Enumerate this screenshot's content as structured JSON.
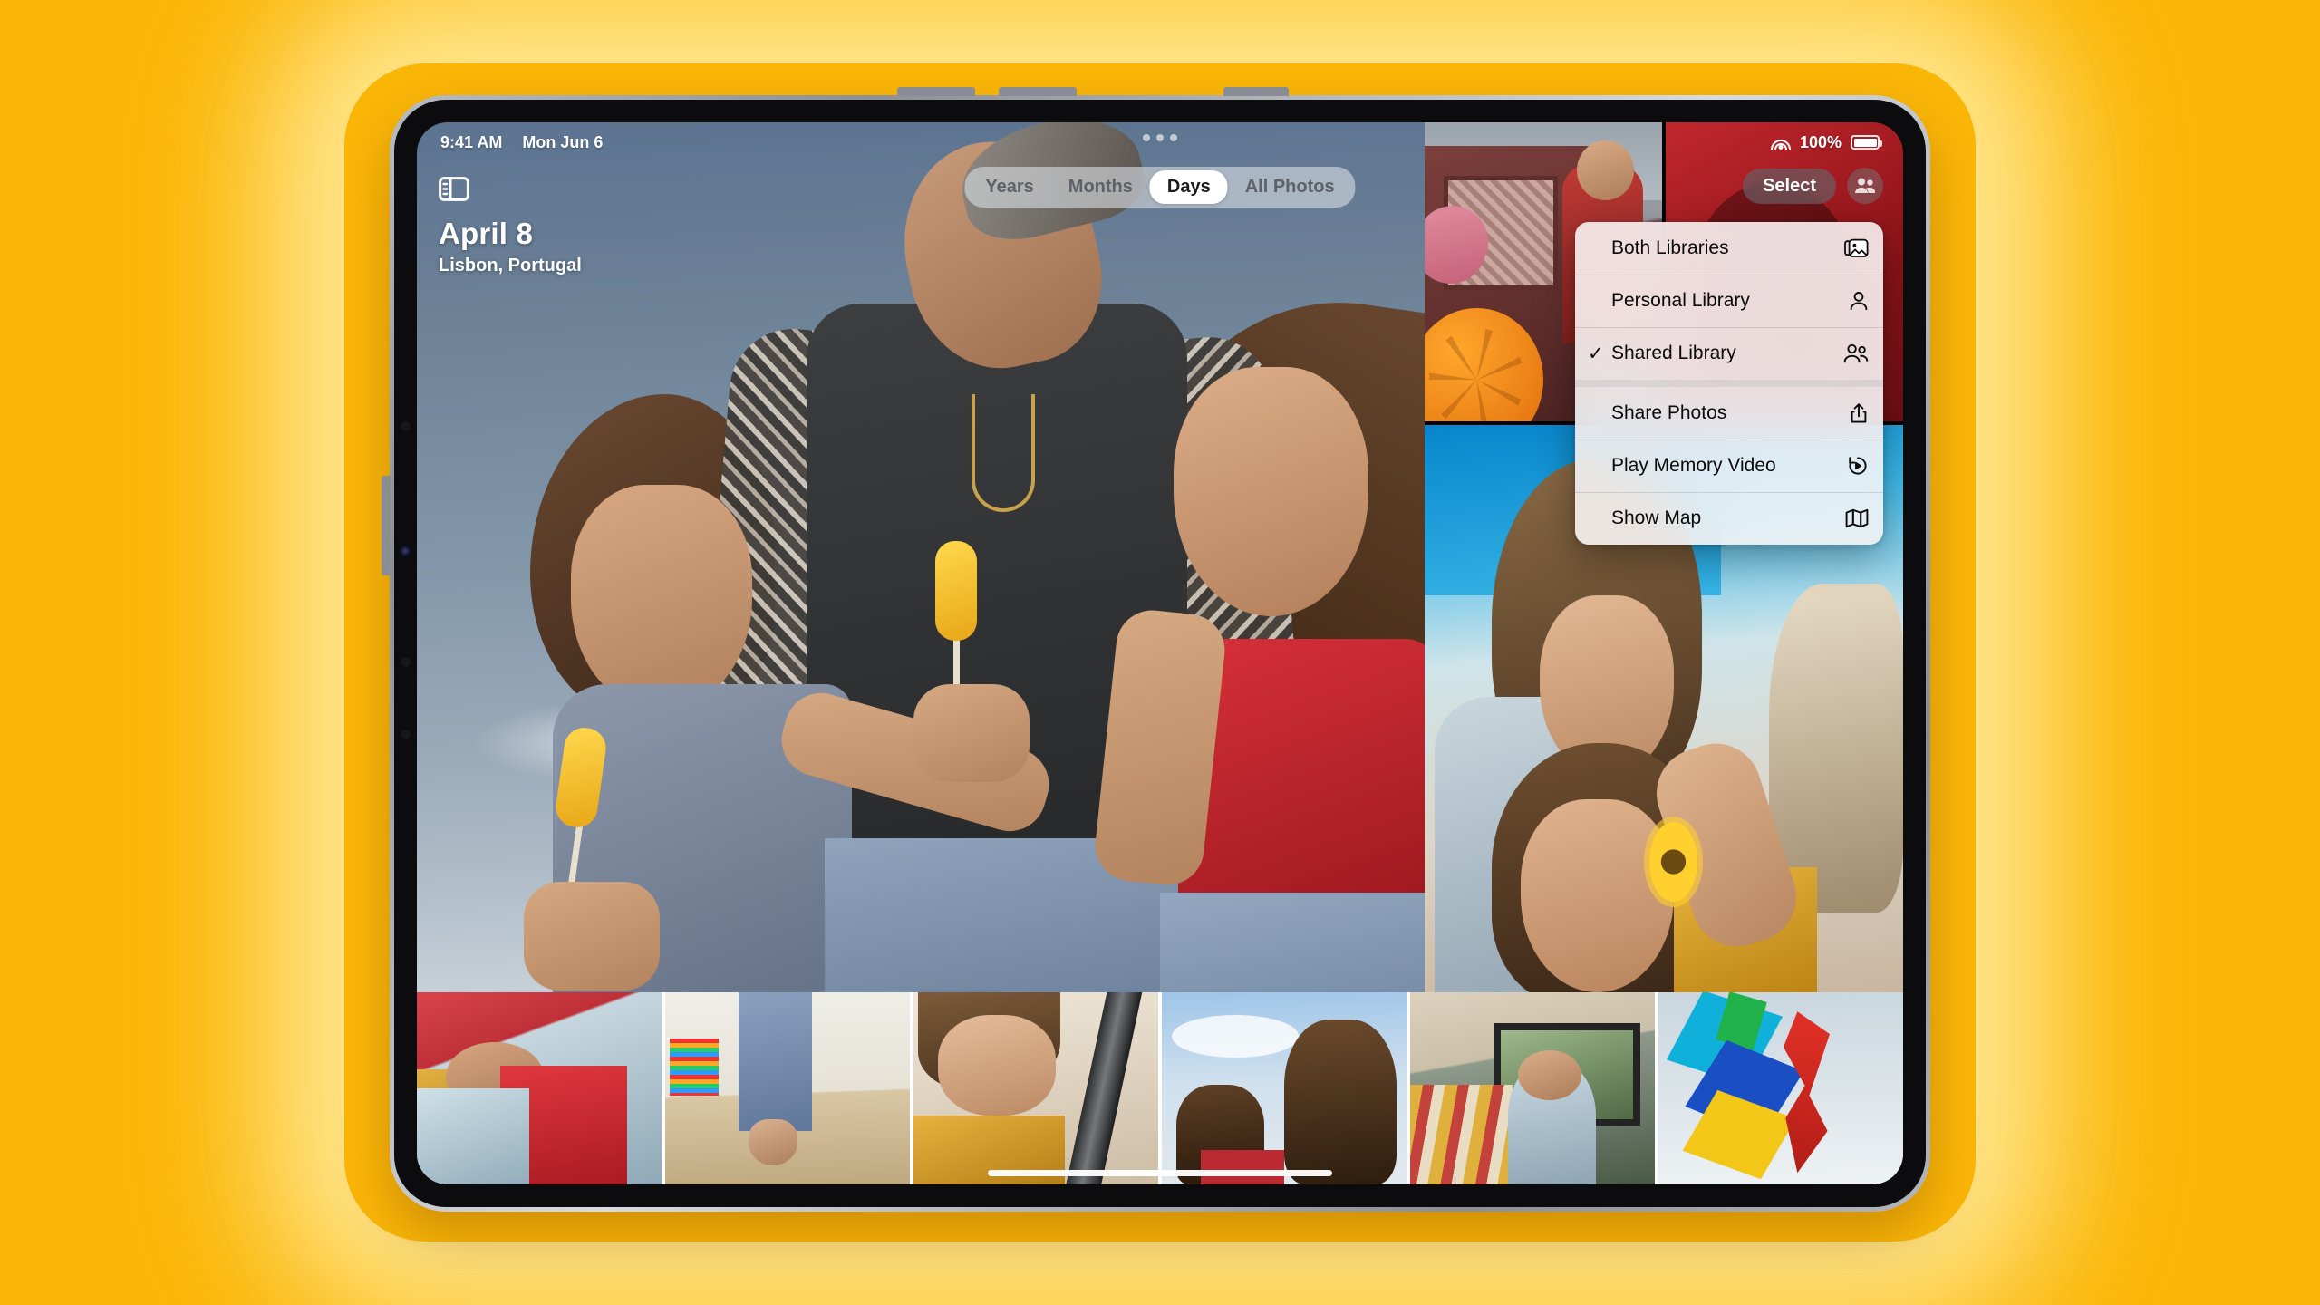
{
  "background": {
    "color": "#FBB707"
  },
  "status_bar": {
    "time": "9:41 AM",
    "date": "Mon Jun 6",
    "battery_percent": "100%",
    "wifi_icon": "wifi-icon",
    "battery_icon": "battery-icon"
  },
  "multitask": {
    "icon": "multitasking-dots-icon",
    "dots": 3
  },
  "toolbar": {
    "sidebar_toggle_icon": "sidebar-toggle-icon",
    "select_label": "Select",
    "shared_library_icon": "shared-library-people-icon"
  },
  "header": {
    "title": "April 8",
    "subtitle": "Lisbon, Portugal"
  },
  "segmented_control": {
    "selected": "Days",
    "options": [
      {
        "label": "Years",
        "selected": false
      },
      {
        "label": "Months",
        "selected": false
      },
      {
        "label": "Days",
        "selected": true
      },
      {
        "label": "All Photos",
        "selected": false
      }
    ]
  },
  "context_menu": {
    "groups": [
      {
        "items": [
          {
            "label": "Both Libraries",
            "icon": "photo-stack-icon",
            "checked": false
          },
          {
            "label": "Personal Library",
            "icon": "person-icon",
            "checked": false
          },
          {
            "label": "Shared Library",
            "icon": "two-people-icon",
            "checked": true
          }
        ]
      },
      {
        "items": [
          {
            "label": "Share Photos",
            "icon": "share-up-arrow-icon",
            "checked": false
          },
          {
            "label": "Play Memory Video",
            "icon": "play-memory-icon",
            "checked": false
          },
          {
            "label": "Show Map",
            "icon": "map-icon",
            "checked": false
          }
        ]
      }
    ]
  },
  "photo_grid": {
    "hero": {
      "name": "hero-photo",
      "alt": "Father carrying two girls eating yellow popsicles against blue sky"
    },
    "right_top_left": {
      "name": "photo-van-soccer-ball",
      "alt": "Girl leaning out of red van window with orange soccer ball"
    },
    "right_top_right": {
      "name": "photo-red-wall",
      "alt": "Red surface close-up"
    },
    "right_large": {
      "name": "photo-girls-flower",
      "alt": "Two girls in car, one holding a yellow sunflower, dog in background"
    },
    "thumbnails": [
      {
        "name": "thumb-girl-red-shirt",
        "alt": "Girl in red shirt lying down"
      },
      {
        "name": "thumb-beach-feet-kite",
        "alt": "Bare feet in sand on beach with kite"
      },
      {
        "name": "thumb-girl-yellow-jacket",
        "alt": "Girl in yellow jacket leaning on car"
      },
      {
        "name": "thumb-girls-sky",
        "alt": "Two girls from behind against a cloudy sky"
      },
      {
        "name": "thumb-girl-van-window",
        "alt": "Girl sitting in van looking out window"
      },
      {
        "name": "thumb-kites",
        "alt": "Colorful kites flying"
      }
    ]
  },
  "home_indicator": {
    "name": "home-indicator"
  }
}
